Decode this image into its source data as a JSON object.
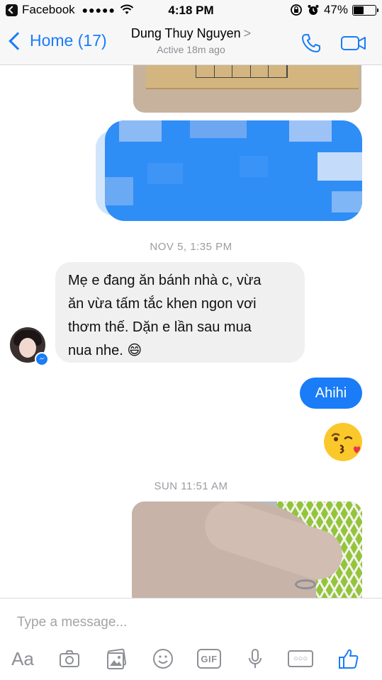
{
  "status_bar": {
    "app_name": "Facebook",
    "signal": "●●●●●",
    "time": "4:18 PM",
    "battery_percent": "47%",
    "battery_level": 0.47
  },
  "header": {
    "back_label": "Home (17)",
    "contact_name": "Dung Thuy Nguyen",
    "contact_caret": ">",
    "contact_status": "Active 18m ago",
    "icons": [
      "phone-icon",
      "video-camera-icon"
    ]
  },
  "conversation": {
    "separators": [
      "NOV 5, 1:35 PM",
      "SUN 11:51 AM"
    ],
    "incoming_message": {
      "lines": [
        "Mẹ e đang ăn bánh nhà c,  vừa",
        "ăn vừa tấm tắc khen ngon vơi",
        "thơm thế.  Dặn e lần sau mua",
        "nua nhe.  😄"
      ]
    },
    "outgoing_message": "Ahihi",
    "sticker": "kiss-emoji"
  },
  "composer": {
    "placeholder": "Type a message...",
    "aa_label": "Aa",
    "gif_label": "GIF",
    "tools": [
      "text-format-icon",
      "camera-icon",
      "gallery-icon",
      "emoji-icon",
      "gif-icon",
      "microphone-icon",
      "more-icon",
      "like-icon"
    ]
  },
  "colors": {
    "accent": "#1a7cf7",
    "incoming_bubble": "#f1f0f0",
    "separator_text": "#9a9ca2"
  }
}
